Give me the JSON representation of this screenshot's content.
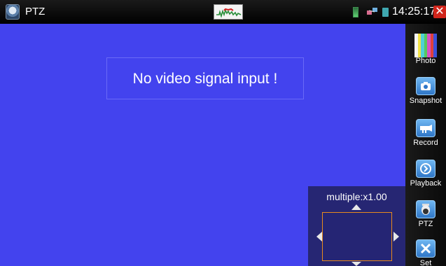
{
  "statusbar": {
    "title": "PTZ",
    "clock": "14:25:17",
    "close_label": "✕"
  },
  "video": {
    "message": "No video signal input  !"
  },
  "ptz_panel": {
    "zoom_label": "multiple:x1.00"
  },
  "sidebar": {
    "items": [
      {
        "label": "Photo",
        "icon": "color-bars-icon"
      },
      {
        "label": "Snapshot",
        "icon": "camera-icon"
      },
      {
        "label": "Record",
        "icon": "video-camera-icon"
      },
      {
        "label": "Playback",
        "icon": "play-icon"
      },
      {
        "label": "PTZ",
        "icon": "dome-camera-icon"
      },
      {
        "label": "Set",
        "icon": "tools-icon"
      }
    ]
  },
  "colors": {
    "video_background": "#4343ee",
    "ptz_panel": "#262673",
    "ptz_frame_border": "#e88a1d",
    "close_button": "#d0251b",
    "icon_blue": "#3b8bd8"
  }
}
